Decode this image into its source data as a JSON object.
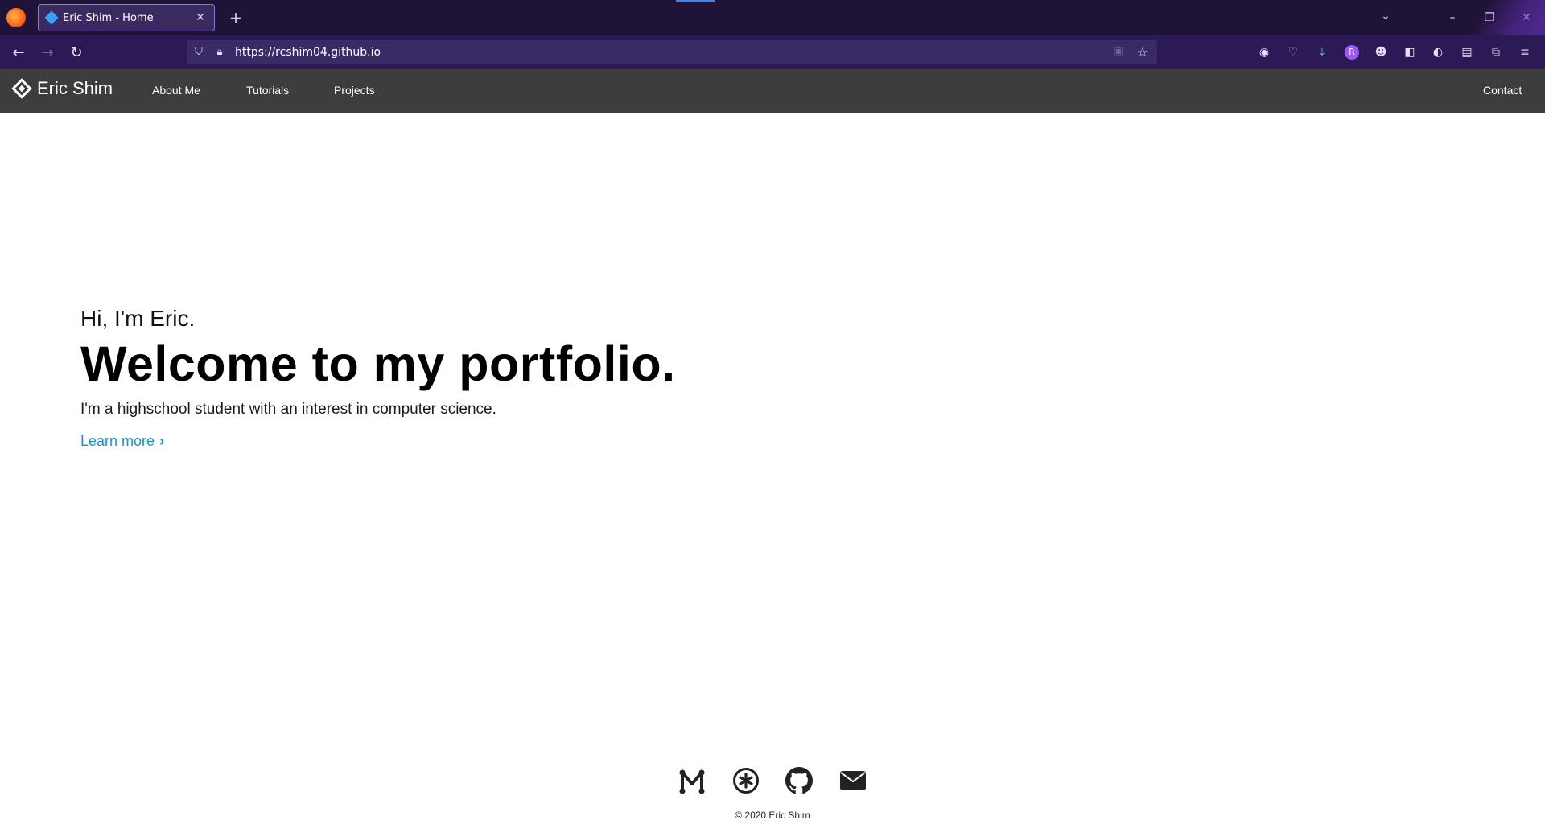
{
  "browser": {
    "tab_title": "Eric Shim - Home",
    "new_tab": "+",
    "url": "https://rcshim04.github.io",
    "tab_list_icon": "chevron-down-icon",
    "window_controls": {
      "minimize": "–",
      "restore": "❐",
      "close": "✕"
    },
    "extensions": [
      "mouse-icon",
      "pocket-icon",
      "download-icon",
      "R",
      "user-icon",
      "shield-icon",
      "cookie-icon",
      "translate-icon",
      "extensions-icon",
      "menu-icon"
    ]
  },
  "site": {
    "brand": "Eric Shim",
    "nav": {
      "about": "About Me",
      "tutorials": "Tutorials",
      "projects": "Projects",
      "contact": "Contact"
    },
    "hero": {
      "intro": "Hi, I'm Eric.",
      "headline": "Welcome to my portfolio.",
      "description": "I'm a highschool student with an interest in computer science.",
      "learn_more": "Learn more"
    },
    "footer": {
      "icons": [
        "medium-icon",
        "asterisk-icon",
        "github-icon",
        "envelope-icon"
      ],
      "copyright": "© 2020 Eric Shim"
    }
  },
  "colors": {
    "tabbar": "#1f1338",
    "toolbar": "#2b1a55",
    "site_nav": "#3d3d3d",
    "link": "#1a8fd4"
  }
}
